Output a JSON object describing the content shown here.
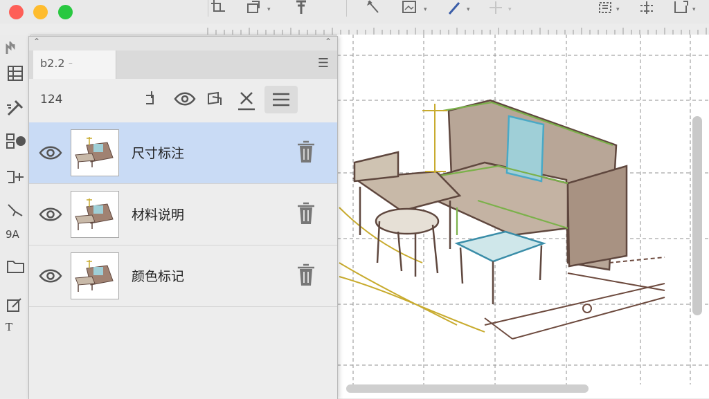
{
  "window": {
    "traffic_lights": {
      "close": "#fe5f57",
      "minimize": "#febc2e",
      "zoom": "#28c840"
    },
    "icons": [
      "crop-icon",
      "transform-icon",
      "pin-icon",
      "pen-icon",
      "image-icon",
      "brush-icon",
      "plus-icon",
      "align-icon",
      "distribute-icon",
      "page-icon"
    ]
  },
  "panel": {
    "tab_label": "b2.2",
    "tools_count": "124",
    "layers": [
      {
        "name": "尺寸标注",
        "selected": true
      },
      {
        "name": "材料说明",
        "selected": false
      },
      {
        "name": "颜色标记",
        "selected": false
      }
    ]
  },
  "left_toolbar": {
    "labels": [
      "9A",
      "T"
    ]
  },
  "colors": {
    "accent": "#c9dbf5",
    "sketch_green": "#7bb14a",
    "sketch_blue": "#4aa9c6",
    "sketch_ochre": "#c8ab2e",
    "sketch_brown": "#6d4a3e"
  }
}
